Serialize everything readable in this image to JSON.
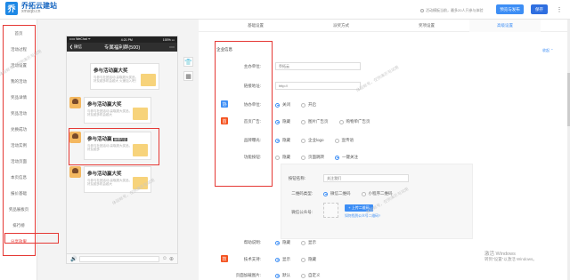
{
  "brand": {
    "name": "乔拓云建站",
    "sub": "xmsqb.cn"
  },
  "top": {
    "hint": "活动模板当前，最多20人只参与体验",
    "preview": "预览与发布",
    "save": "保存",
    "exit": "⋮"
  },
  "sidebar": {
    "items": [
      "首页",
      "活动过程",
      "活动设置",
      "我的活动",
      "奖品详情",
      "奖品活动",
      "兑换成功",
      "活动实例",
      "活动页面",
      "本页信息",
      "报价基础",
      "奖品展板页",
      "排行榜",
      "分享效果"
    ]
  },
  "phone": {
    "status_left": "••••• WeChat ᯤ",
    "status_time": "4:21 PM",
    "status_right": "100% ▭",
    "back": "❮ 微信",
    "title": "专属福利群(500)",
    "more": "⋯",
    "cards": [
      {
        "title": "参与活动赢大奖",
        "desc": "与参与社团活动 赢取超大奖品，好友越多机会越大 火速加入吧！"
      },
      {
        "title": "参与活动赢大奖",
        "desc": "与参与社团活动 赢取超大奖品，好友越多机会越大"
      },
      {
        "title": "参与活动赢",
        "tag": "编辑内容",
        "desc": "与参与社团活动 赢取超大奖品，好友越多"
      },
      {
        "title": "参与活动赢大奖",
        "desc": "与参与社团活动 赢取超大奖品，好友越多机会越大"
      }
    ],
    "voice": "🔊",
    "emoji": "☺",
    "plus": "⊕"
  },
  "tools": {
    "shirt": "👕",
    "grid": "▦"
  },
  "tabs": [
    "基础设置",
    "派奖方式",
    "奖项设置",
    "高级设置"
  ],
  "panel": {
    "collapse": "收起 ⌃",
    "section": "企业信息",
    "labels": {
      "host": "主办单位:",
      "link": "链接地址:",
      "co": "协办单位:",
      "ads": "首页广告:",
      "brand": "品牌曝光:",
      "follow": "功能按钮:",
      "followname": "按钮名称:",
      "qrcode": "二维码类型:",
      "wechat": "微信公众号:",
      "help": "帮助说明:",
      "tech": "技术支持:",
      "footer": "页面加载图片:"
    },
    "host_value": "乔拓云",
    "link_value": "http://",
    "badge_co": "协",
    "badge_ads": "首",
    "badge_tech": "技",
    "co_opts": [
      "关闭",
      "开启"
    ],
    "ads_opts": [
      "隐藏",
      "图片广告页",
      "购物单广告页"
    ],
    "brand_opts": [
      "隐藏",
      "企业logo",
      "宣传语"
    ],
    "follow_opts": [
      "隐藏",
      "页面跳转",
      "一键关注"
    ],
    "follow_name": "关注我们",
    "qr_opts": [
      "微信二维码",
      "小程序二维码"
    ],
    "upload": "+ 上传二维码",
    "qr_link": "如何找到公众号二维码?",
    "help_opts": [
      "隐藏",
      "显示"
    ],
    "tech_opts": [
      "显示",
      "隐藏"
    ],
    "footer_opts": [
      "默认",
      "自定义"
    ]
  },
  "watermark": "体验帐号，仅供演示与试用",
  "activate": {
    "line1": "激活 Windows",
    "line2": "转到\"设置\"以激活 Windows。"
  }
}
